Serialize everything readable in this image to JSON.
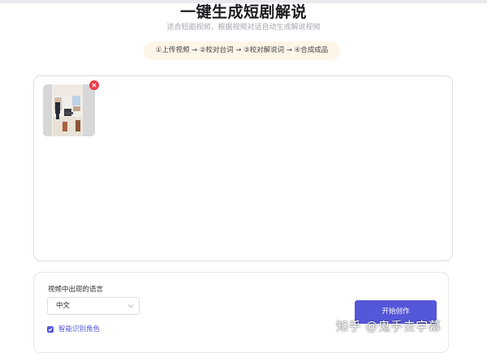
{
  "header": {
    "title": "一键生成短剧解说",
    "subtitle": "适合短剧视频，根据视频对话自动生成解说视频",
    "steps": "①上传视频 → ②校对台词 → ③校对解说词 → ④合成成品"
  },
  "upload": {
    "thumbnail_icon": "video-thumbnail",
    "remove_icon": "close-icon"
  },
  "settings": {
    "language_label": "视频中出现的语言",
    "language_value": "中文",
    "smart_role_label": "智能识别角色",
    "smart_role_checked": true,
    "start_button": "开始创作"
  },
  "watermark": "知乎 @鬼手去字幕",
  "colors": {
    "accent": "#5557d9",
    "remove": "#ee3b45",
    "steps_bg": "#fdf5e7"
  }
}
